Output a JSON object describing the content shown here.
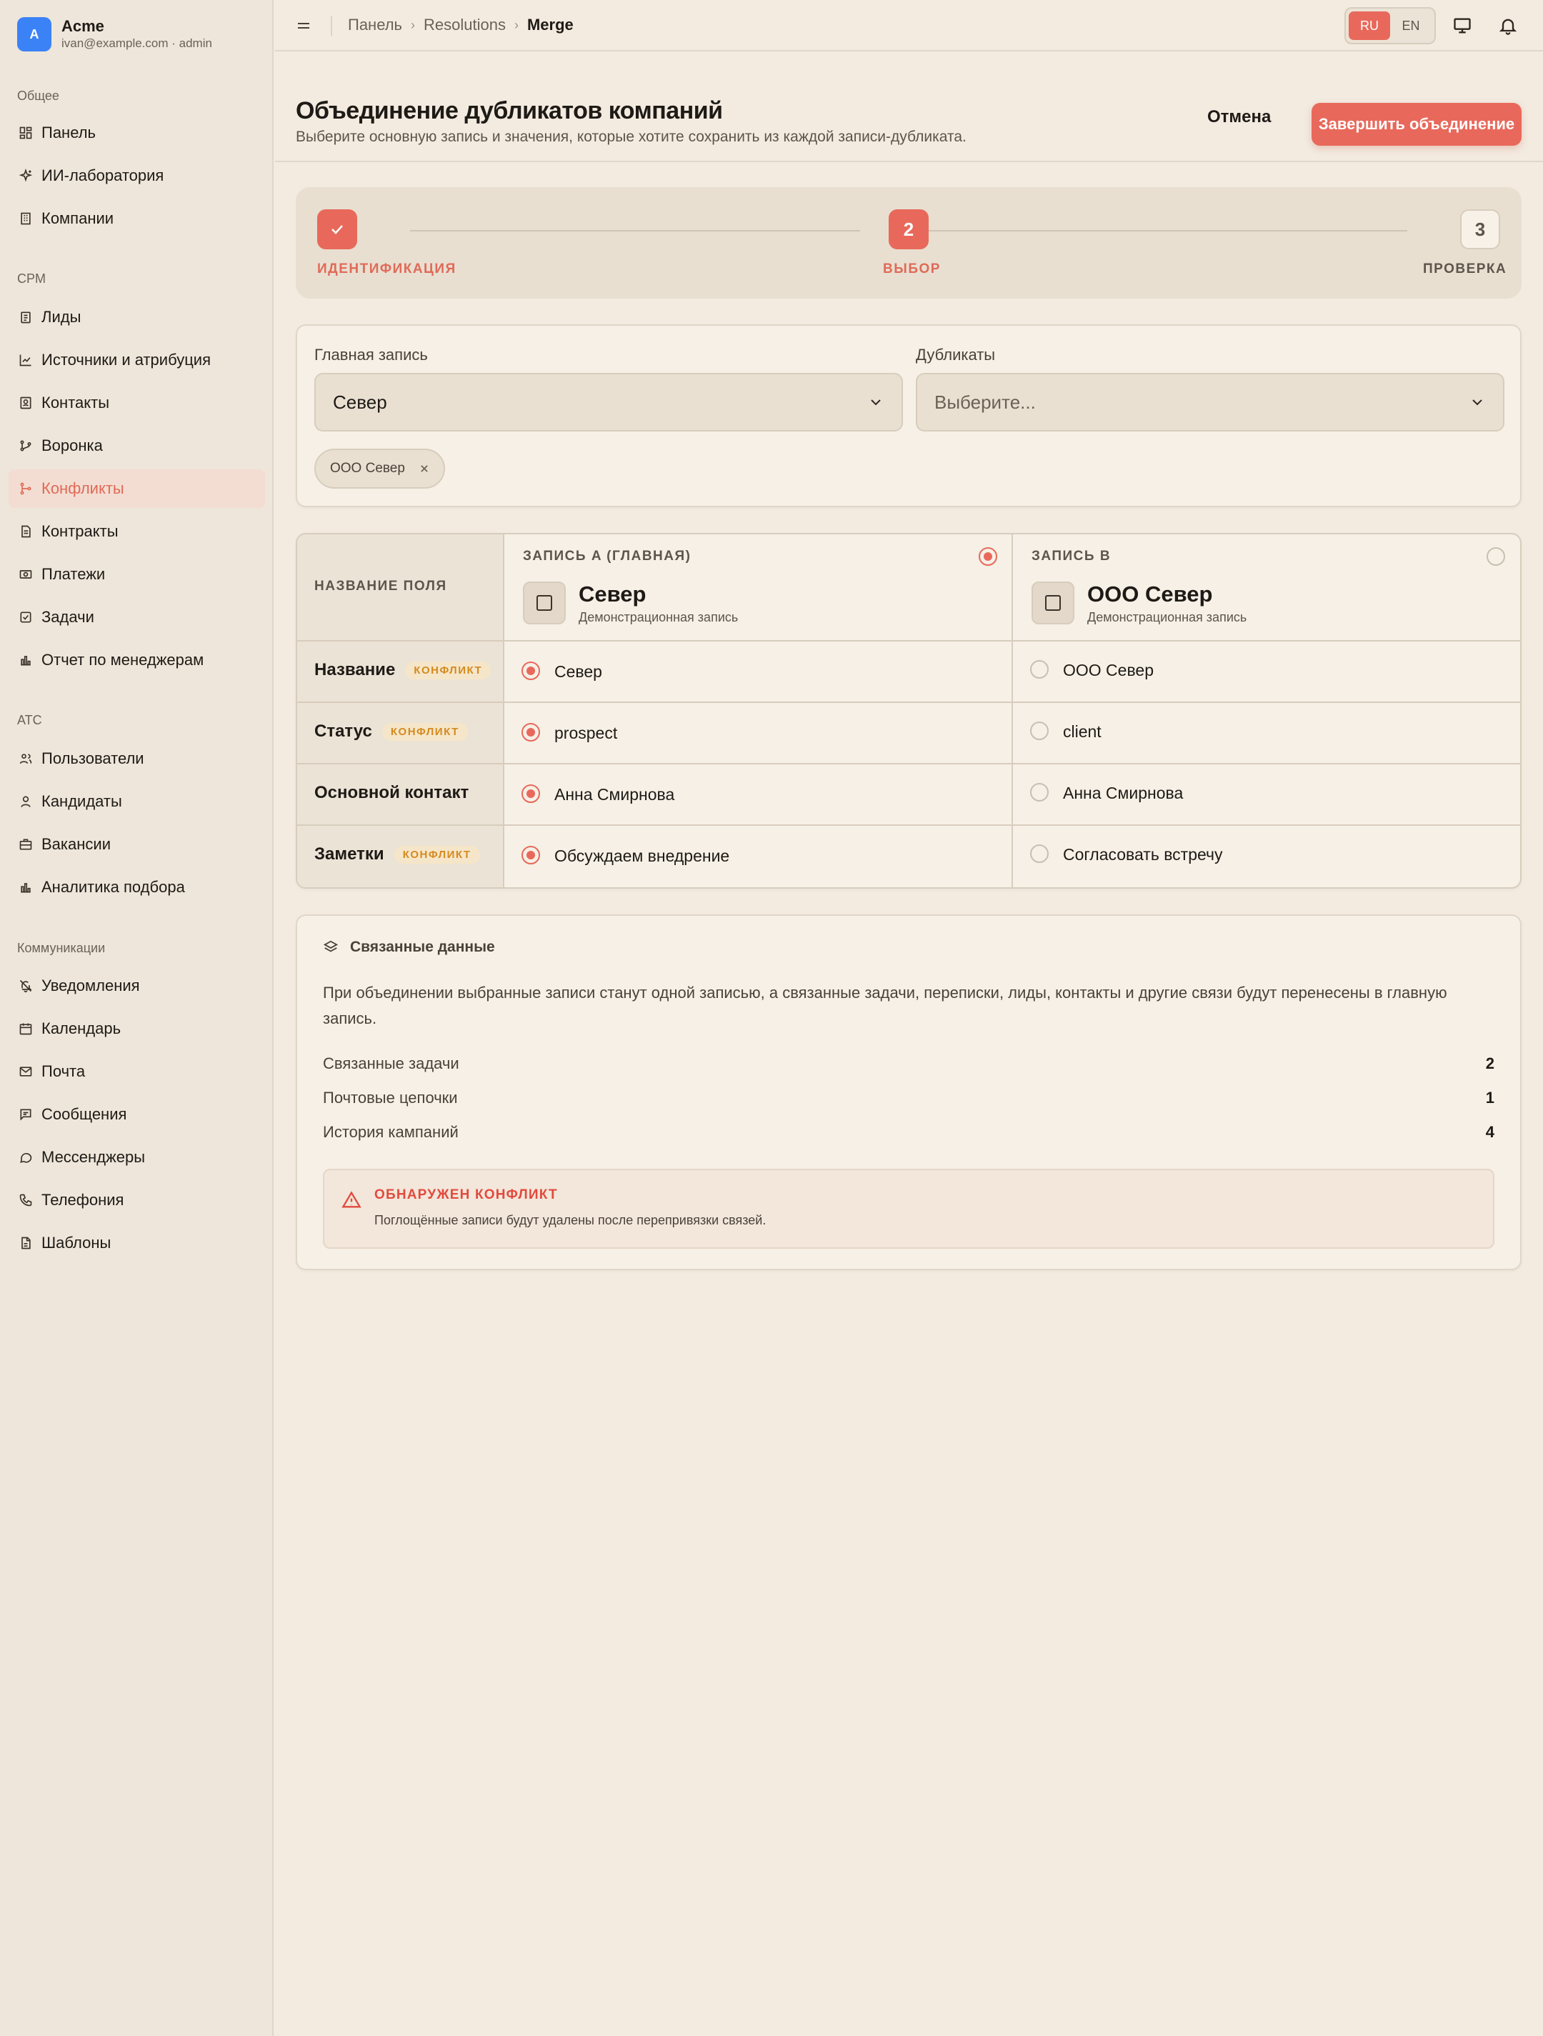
{
  "app": {
    "avatar_letter": "A",
    "name": "Acme",
    "user": "ivan@example.com · admin"
  },
  "sidebar": {
    "sections": [
      {
        "title": "Общее",
        "items": [
          {
            "label": "Панель",
            "icon": "dashboard-icon"
          },
          {
            "label": "ИИ-лаборатория",
            "icon": "sparkles-icon"
          },
          {
            "label": "Компании",
            "icon": "building-icon"
          }
        ]
      },
      {
        "title": "CPM",
        "items": [
          {
            "label": "Лиды",
            "icon": "clipboard-icon"
          },
          {
            "label": "Источники и атрибуция",
            "icon": "chart-line-icon"
          },
          {
            "label": "Контакты",
            "icon": "contact-card-icon"
          },
          {
            "label": "Воронка",
            "icon": "funnel-icon"
          },
          {
            "label": "Конфликты",
            "icon": "git-merge-icon",
            "active": true
          },
          {
            "label": "Контракты",
            "icon": "document-icon"
          },
          {
            "label": "Платежи",
            "icon": "banknote-icon"
          },
          {
            "label": "Задачи",
            "icon": "checkbox-icon"
          },
          {
            "label": "Отчет по менеджерам",
            "icon": "bar-chart-icon"
          }
        ]
      },
      {
        "title": "ATC",
        "items": [
          {
            "label": "Пользователи",
            "icon": "users-icon"
          },
          {
            "label": "Кандидаты",
            "icon": "user-icon"
          },
          {
            "label": "Вакансии",
            "icon": "briefcase-icon"
          },
          {
            "label": "Аналитика подбора",
            "icon": "bar-chart-icon"
          }
        ]
      },
      {
        "title": "Коммуникации",
        "items": [
          {
            "label": "Уведомления",
            "icon": "bell-off-icon"
          },
          {
            "label": "Календарь",
            "icon": "calendar-icon"
          },
          {
            "label": "Почта",
            "icon": "mail-icon"
          },
          {
            "label": "Сообщения",
            "icon": "message-square-icon"
          },
          {
            "label": "Мессенджеры",
            "icon": "chat-bubble-icon"
          },
          {
            "label": "Телефония",
            "icon": "phone-icon"
          },
          {
            "label": "Шаблоны",
            "icon": "file-text-icon"
          }
        ]
      }
    ]
  },
  "topbar": {
    "breadcrumb": [
      "Панель",
      "Resolutions",
      "Merge"
    ],
    "lang": {
      "ru": "RU",
      "en": "EN",
      "active": "RU"
    }
  },
  "page": {
    "title": "Объединение дубликатов компаний",
    "subtitle": "Выберите основную запись и значения, которые хотите сохранить из каждой записи-дубликата.",
    "cancel_label": "Отмена",
    "finish_label": "Завершить объединение"
  },
  "stepper": {
    "steps": [
      {
        "number": "1",
        "label": "ИДЕНТИФИКАЦИЯ",
        "state": "done"
      },
      {
        "number": "2",
        "label": "ВЫБОР",
        "state": "current"
      },
      {
        "number": "3",
        "label": "ПРОВЕРКА",
        "state": "pending"
      }
    ]
  },
  "selection": {
    "main_label": "Главная запись",
    "main_value": "Север",
    "dup_label": "Дубликаты",
    "dup_placeholder": "Выберите...",
    "chips": [
      "ООО Север"
    ]
  },
  "compare": {
    "field_header": "НАЗВАНИЕ ПОЛЯ",
    "record_a": {
      "header": "ЗАПИСЬ A (ГЛАВНАЯ)",
      "name": "Север",
      "sub": "Демонстрационная запись",
      "selected": true
    },
    "record_b": {
      "header": "ЗАПИСЬ B",
      "name": "ООО Север",
      "sub": "Демонстрационная запись",
      "selected": false
    },
    "conflict_badge": "КОНФЛИКТ",
    "rows": [
      {
        "field": "Название",
        "conflict": true,
        "a": "Север",
        "b": "ООО Север"
      },
      {
        "field": "Статус",
        "conflict": true,
        "a": "prospect",
        "b": "client"
      },
      {
        "field": "Основной контакт",
        "conflict": false,
        "a": "Анна Смирнова",
        "b": "Анна Смирнова"
      },
      {
        "field": "Заметки",
        "conflict": true,
        "a": "Обсуждаем внедрение",
        "b": "Согласовать встречу"
      }
    ]
  },
  "related": {
    "title": "Связанные данные",
    "description": "При объединении выбранные записи станут одной записью, а связанные задачи, переписки, лиды, контакты и другие связи будут перенесены в главную запись.",
    "stats": [
      {
        "label": "Связанные задачи",
        "value": "2"
      },
      {
        "label": "Почтовые цепочки",
        "value": "1"
      },
      {
        "label": "История кампаний",
        "value": "4"
      }
    ],
    "alert_title": "ОБНАРУЖЕН КОНФЛИКТ",
    "alert_text": "Поглощённые записи будут удалены после перепривязки связей."
  },
  "colors": {
    "accent": "#e8695b",
    "warning": "#d48a1f",
    "danger": "#e04b3e",
    "background": "#f3ebe0",
    "sidebar": "#eee6da"
  }
}
